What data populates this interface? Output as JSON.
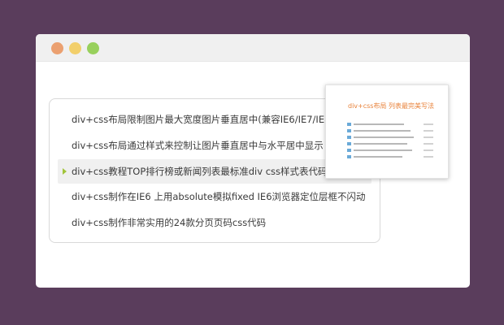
{
  "window": {
    "controls": [
      "close",
      "minimize",
      "maximize"
    ]
  },
  "list": {
    "items": [
      {
        "label": "div+css布局限制图片最大宽度图片垂直居中(兼容IE6/IE7/IE8/"
      },
      {
        "label": "div+css布局通过样式来控制让图片垂直居中与水平居中显示"
      },
      {
        "label": "div+css教程TOP排行榜或新闻列表最标准div css样式表代码写"
      },
      {
        "label": "div+css制作在IE6 上用absolute模拟fixed IE6浏览器定位层框不闪动"
      },
      {
        "label": "div+css制作非常实用的24款分页页码css代码"
      }
    ],
    "active_index": 2
  },
  "preview": {
    "title": "div+css布局 列表最完美写法",
    "row_count": 6
  },
  "colors": {
    "background": "#5a3d5c",
    "accent_arrow": "#a1c43a",
    "preview_title": "#e8823a",
    "preview_icon": "#6aaad8"
  }
}
